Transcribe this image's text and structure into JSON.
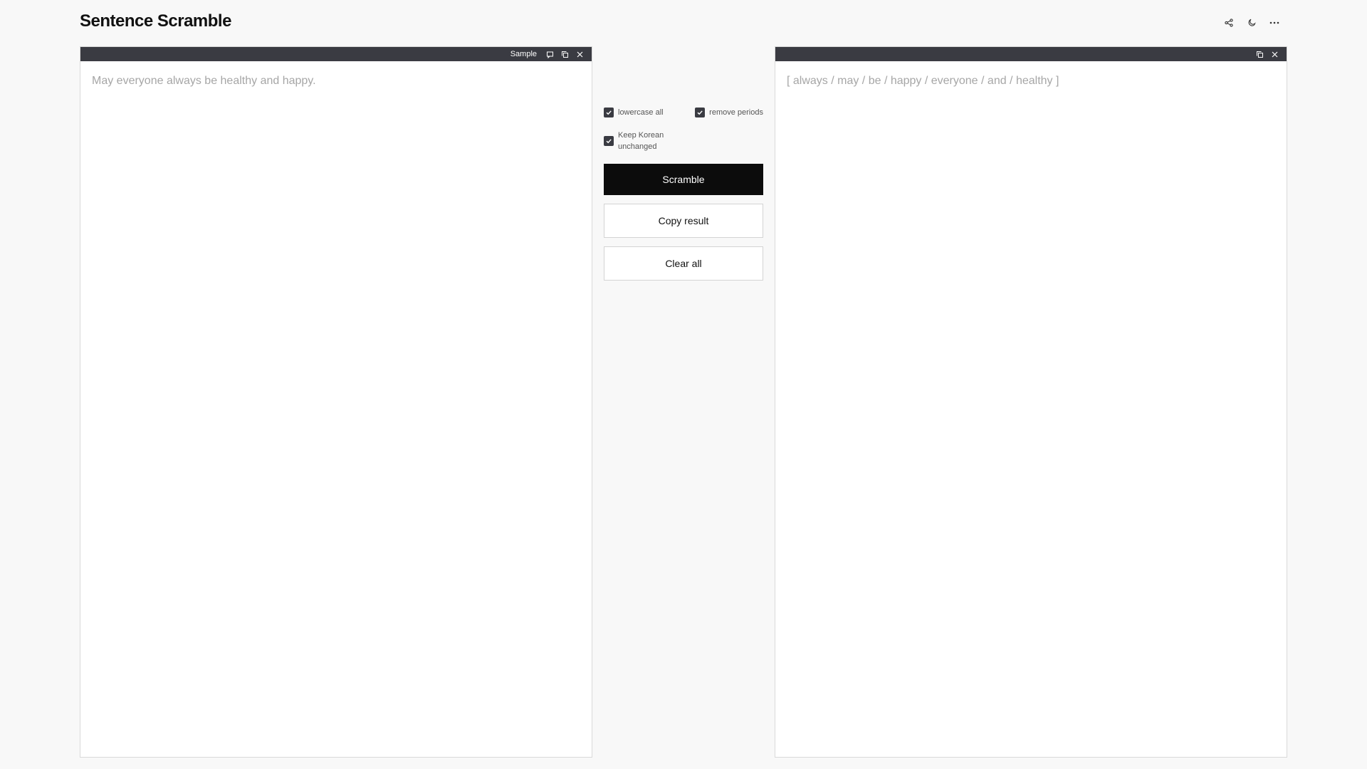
{
  "app": {
    "title": "Sentence Scramble"
  },
  "header": {
    "actions": [
      {
        "icon": "share-icon"
      },
      {
        "icon": "moon-icon"
      },
      {
        "icon": "more-icon"
      }
    ]
  },
  "input_panel": {
    "sample_label": "Sample",
    "text": "May everyone always be healthy and happy."
  },
  "output_panel": {
    "text": "[ always / may / be / happy / everyone / and / healthy ]"
  },
  "options": {
    "lowercase_all": {
      "label": "lowercase all",
      "checked": true
    },
    "remove_periods": {
      "label": "remove periods",
      "checked": true
    },
    "keep_korean": {
      "label_line1": "Keep Korean",
      "label_line2": "unchanged",
      "checked": true
    }
  },
  "buttons": {
    "scramble": "Scramble",
    "copy_result": "Copy result",
    "clear_all": "Clear all"
  },
  "colors": {
    "bar": "#3a3b42",
    "primary_button": "#0c0c0c",
    "placeholder_text": "#a6a6a6"
  }
}
